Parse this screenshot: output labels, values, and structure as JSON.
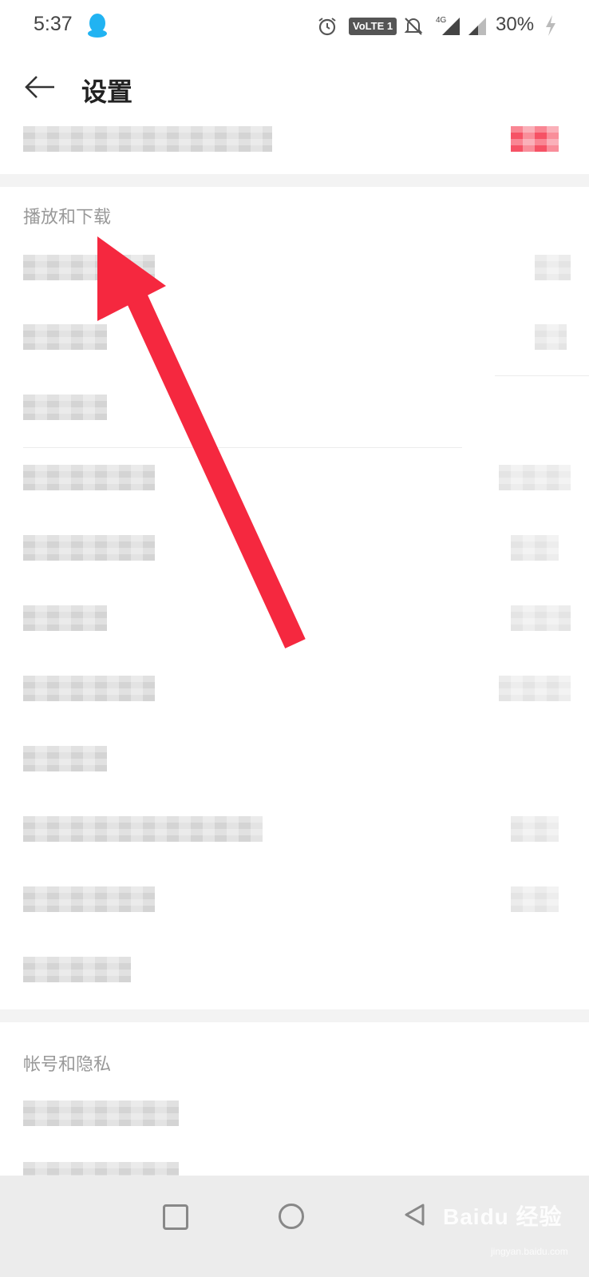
{
  "status_bar": {
    "time": "5:37",
    "volte": "VoLTE 1",
    "network": "4G",
    "battery": "30%"
  },
  "header": {
    "title": "设置"
  },
  "sections": {
    "playback": "播放和下载",
    "account": "帐号和隐私"
  },
  "nav": {
    "watermark": "Baidu 经验",
    "watermark_sub": "jingyan.baidu.com"
  },
  "colors": {
    "accent": "#f5283f",
    "label": "#999999",
    "navbar": "#ececec"
  },
  "icons": [
    "qq-icon",
    "alarm-icon",
    "bell-off-icon",
    "signal-icon",
    "charging-icon",
    "back-arrow-icon",
    "recent-apps-icon",
    "home-icon",
    "nav-back-icon"
  ]
}
